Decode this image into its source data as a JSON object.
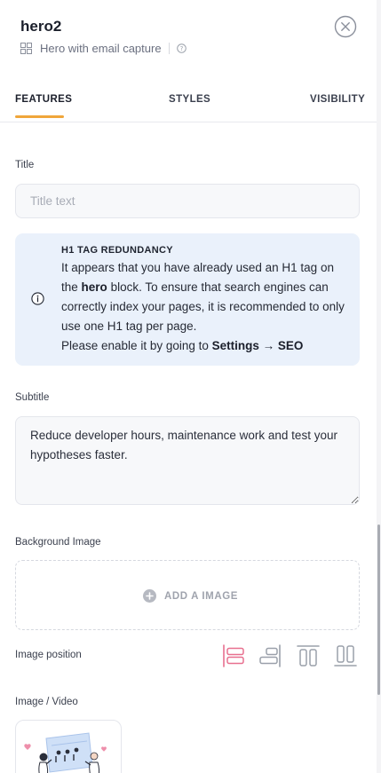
{
  "header": {
    "title": "hero2",
    "block_type": "Hero with email capture"
  },
  "tabs": [
    {
      "label": "FEATURES",
      "active": true
    },
    {
      "label": "STYLES",
      "active": false
    },
    {
      "label": "VISIBILITY",
      "active": false
    }
  ],
  "fields": {
    "title": {
      "label": "Title",
      "placeholder": "Title text",
      "value": ""
    },
    "notice": {
      "heading": "H1 TAG REDUNDANCY",
      "line1": "It appears that you have already used an H1 tag on the",
      "block_name": "hero",
      "line2": "block. To ensure that search engines can correctly index your pages, it is recommended to only use one H1 tag per page.",
      "line3": "Please enable it by going to",
      "settings_path": "Settings → SEO"
    },
    "subtitle": {
      "label": "Subtitle",
      "value": "Reduce developer hours, maintenance work and test your hypotheses faster."
    },
    "background_image": {
      "label": "Background Image",
      "add_label": "ADD A IMAGE"
    },
    "image_position": {
      "label": "Image position",
      "options": [
        "left",
        "right",
        "top",
        "bottom"
      ],
      "selected": "left"
    },
    "image_video": {
      "label": "Image / Video"
    }
  },
  "colors": {
    "accent": "#f0a63a",
    "selected_icon": "#e8708f",
    "icon_gray": "#9aa0aa",
    "notice_bg": "#eaf1fb"
  }
}
